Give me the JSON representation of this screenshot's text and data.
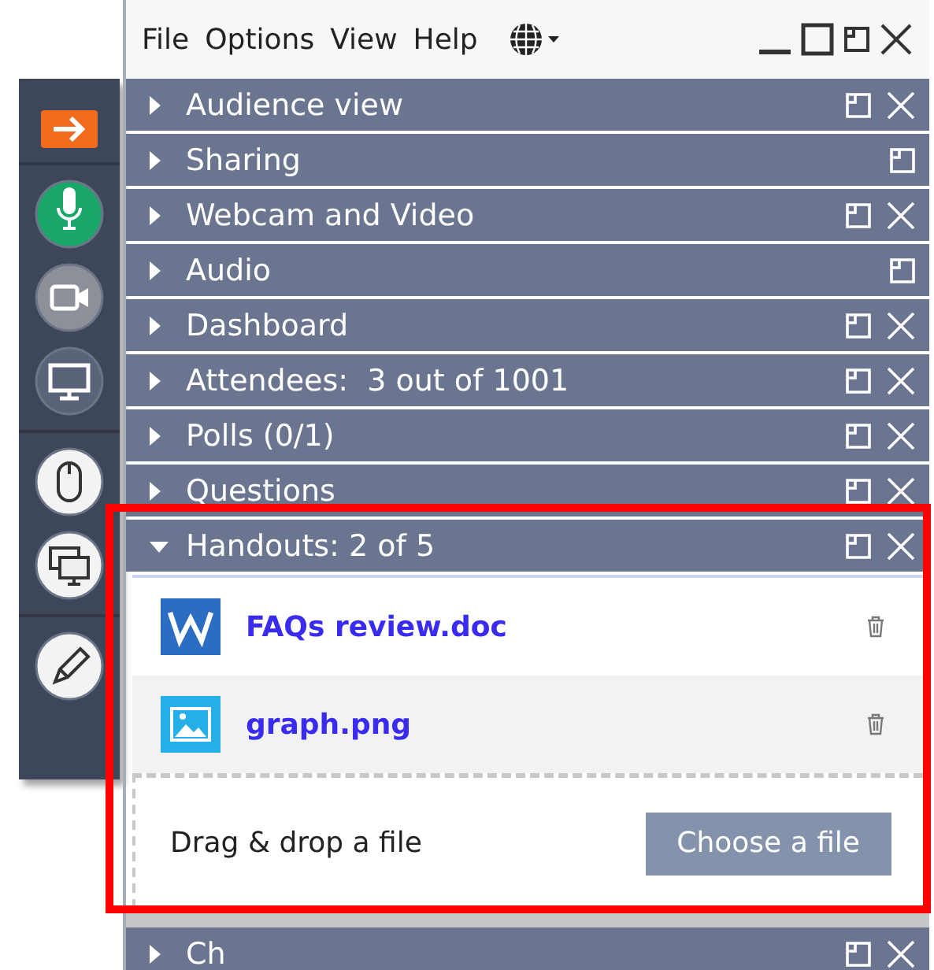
{
  "menu": [
    "File",
    "Options",
    "View",
    "Help"
  ],
  "toolbar": [
    {
      "kind": "arrow"
    },
    {
      "kind": "separator"
    },
    {
      "kind": "mic",
      "on": true
    },
    {
      "kind": "camera",
      "on": false
    },
    {
      "kind": "monitor",
      "on": false
    },
    {
      "kind": "separator"
    },
    {
      "kind": "mouse",
      "on": false
    },
    {
      "kind": "screens",
      "on": false
    },
    {
      "kind": "separator"
    },
    {
      "kind": "pen",
      "on": false
    }
  ],
  "sections": [
    {
      "title": "Audience view",
      "expanded": false,
      "closable": true
    },
    {
      "title": "Sharing",
      "expanded": false,
      "closable": false
    },
    {
      "title": "Webcam and Video",
      "expanded": false,
      "closable": true
    },
    {
      "title": "Audio",
      "expanded": false,
      "closable": false
    },
    {
      "title": "Dashboard",
      "expanded": false,
      "closable": true
    },
    {
      "title": "Attendees:  3 out of 1001",
      "expanded": false,
      "closable": true
    },
    {
      "title": "Polls (0/1)",
      "expanded": false,
      "closable": true
    },
    {
      "title": "Questions",
      "expanded": false,
      "closable": true
    },
    {
      "title": "Handouts: 2 of 5",
      "expanded": true,
      "closable": true,
      "files": [
        {
          "name": "FAQs review.doc",
          "kind": "word",
          "selected": false
        },
        {
          "name": "graph.png",
          "kind": "image",
          "selected": true
        }
      ],
      "drop_text": "Drag & drop a file",
      "button": "Choose a file"
    },
    {
      "title": "Ch",
      "expanded": false,
      "closable": true
    }
  ]
}
